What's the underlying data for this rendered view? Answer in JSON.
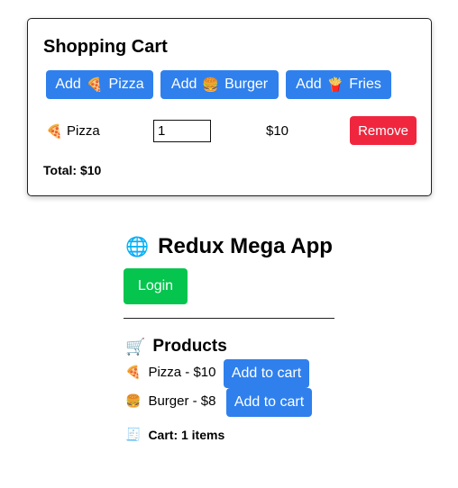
{
  "cart": {
    "title": "Shopping Cart",
    "add_buttons": [
      {
        "prefix": "Add",
        "icon": "🍕",
        "label": "Pizza"
      },
      {
        "prefix": "Add",
        "icon": "🍔",
        "label": "Burger"
      },
      {
        "prefix": "Add",
        "icon": "🍟",
        "label": "Fries"
      }
    ],
    "items": [
      {
        "icon": "🍕",
        "name": "Pizza",
        "quantity": "1",
        "price": "$10",
        "remove_label": "Remove"
      }
    ],
    "total": "Total: $10"
  },
  "app": {
    "icon": "🌐",
    "title": "Redux Mega App",
    "login_label": "Login",
    "products_icon": "🛒",
    "products_title": "Products",
    "products": [
      {
        "icon": "🍕",
        "text": "Pizza - $10",
        "button": "Add to cart"
      },
      {
        "icon": "🍔",
        "text": "Burger - $8",
        "button": "Add to cart"
      }
    ],
    "cart_icon": "🧾",
    "cart_summary": "Cart: 1 items"
  },
  "colors": {
    "primary": "#2f80ed",
    "danger": "#f0263f",
    "success": "#05c54e"
  }
}
